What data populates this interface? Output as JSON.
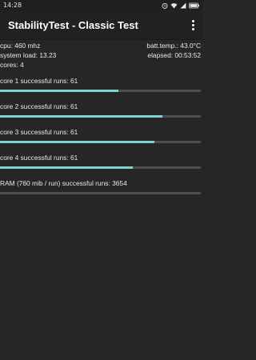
{
  "status_bar": {
    "time": "14:28",
    "battery_color": "#ffffff"
  },
  "app_bar": {
    "title": "StabilityTest - Classic Test",
    "menu_icon": "overflow-dots-icon"
  },
  "stats": {
    "cpu": "cpu: 460 mhz",
    "batt_temp": "batt.temp.: 43.0°C",
    "system_load": "system load: 13.23",
    "elapsed": "elapsed: 00:53:52",
    "cores": "cores: 4"
  },
  "cores": [
    {
      "label": "core 1 successful runs: 61",
      "progress": 0.59
    },
    {
      "label": "core 2 successful runs: 61",
      "progress": 0.81
    },
    {
      "label": "core 3 successful runs: 61",
      "progress": 0.77
    },
    {
      "label": "core 4 successful runs: 61",
      "progress": 0.66
    }
  ],
  "ram": {
    "label": "RAM (760 mib / run) successful runs: 3654"
  },
  "colors": {
    "background": "#262626",
    "app_bar": "#212121",
    "progress_fill": "#7ed1d1",
    "progress_track": "#4d4d4d"
  }
}
